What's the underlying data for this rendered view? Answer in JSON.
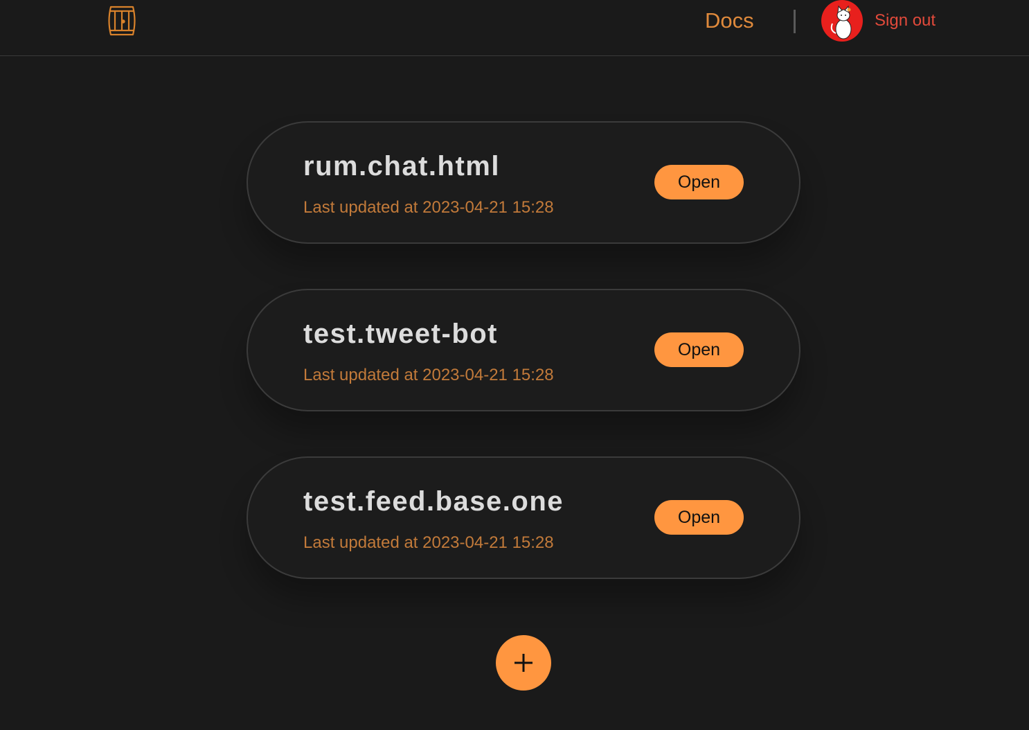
{
  "header": {
    "logo_icon": "barrel-icon",
    "docs_label": "Docs",
    "avatar_icon": "cat-avatar-icon",
    "signout_label": "Sign out"
  },
  "projects": [
    {
      "name": "rum.chat.html",
      "updated": "Last updated at 2023-04-21 15:28",
      "open_label": "Open"
    },
    {
      "name": "test.tweet-bot",
      "updated": "Last updated at 2023-04-21 15:28",
      "open_label": "Open"
    },
    {
      "name": "test.feed.base.one",
      "updated": "Last updated at 2023-04-21 15:28",
      "open_label": "Open"
    }
  ],
  "add_button": {
    "icon": "plus-icon"
  },
  "colors": {
    "background": "#1a1a1a",
    "accent": "#ff9640",
    "docs_link": "#e08a3c",
    "signout": "#e24a3b",
    "updated_text": "#c27a3a",
    "title_text": "#dcdcdc",
    "card_border": "#3b3b3b"
  }
}
